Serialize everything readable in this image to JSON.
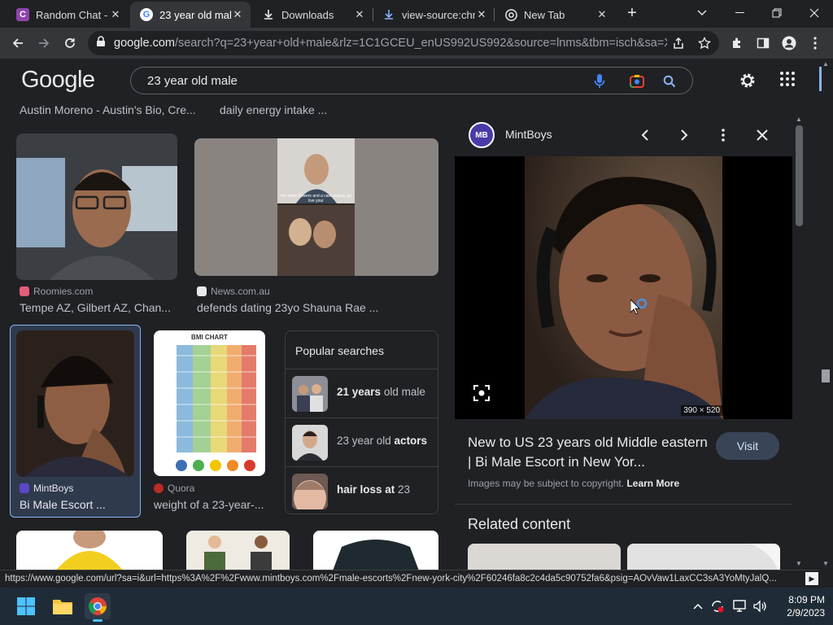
{
  "browser": {
    "tabs": [
      {
        "title": "Random Chat - ",
        "favicon": "C",
        "favicon_color": "#8e44ad",
        "active": false
      },
      {
        "title": "23 year old male",
        "favicon": "G",
        "favicon_color": "#ffffff",
        "active": true
      },
      {
        "title": "Downloads",
        "favicon": "download-icon",
        "active": false
      },
      {
        "title": "view-source:chr",
        "favicon": "download-icon",
        "active": false
      },
      {
        "title": "New Tab",
        "favicon": "chrome-icon",
        "active": false
      }
    ],
    "url_host": "google.com",
    "url_rest": "/search?q=23+year+old+male&rlz=1C1GCEU_enUS992US992&source=lnms&tbm=isch&sa=X..."
  },
  "google": {
    "logo": "Google",
    "query": "23 year old male"
  },
  "results": {
    "top_captions": [
      "Austin Moreno - Austin's Bio, Cre...",
      "daily energy intake ..."
    ],
    "row1": [
      {
        "source": "Roomies.com",
        "caption": "Tempe AZ, Gilbert AZ, Chan..."
      },
      {
        "source": "News.com.au",
        "caption": "defends dating 23yo Shauna Rae ..."
      }
    ],
    "row2": [
      {
        "source": "MintBoys",
        "caption": "Bi Male Escort ..."
      },
      {
        "source": "Quora",
        "caption": "weight of a 23-year-..."
      }
    ],
    "news_overlay": "her some flowers and a card saying, go live your",
    "bmi_chart_label": "BMI CHART",
    "popular": {
      "title": "Popular searches",
      "items": [
        {
          "bold": "21 years",
          "rest": " old male",
          "bold_first": true
        },
        {
          "bold": "actors",
          "rest": "23 year old ",
          "bold_first": false
        },
        {
          "bold": "hair loss at",
          "rest": " 23",
          "bold_first": true
        }
      ]
    }
  },
  "panel": {
    "site": "MintBoys",
    "logo_text": "MB",
    "dimensions": "390 × 520",
    "title": "New to US 23 years old Middle eastern | Bi Male Escort in New Yor...",
    "visit": "Visit",
    "copyright_text": "Images may be subject to copyright.",
    "learn_more": "Learn More",
    "related": "Related content"
  },
  "status_url": "https://www.google.com/url?sa=i&url=https%3A%2F%2Fwww.mintboys.com%2Fmale-escorts%2Fnew-york-city%2F60246fa8c2c4da5c90752fa6&psig=AOvVaw1LaxCC3sA3YoMtyJalQ...",
  "taskbar": {
    "time": "8:09 PM",
    "date": "2/9/2023"
  }
}
